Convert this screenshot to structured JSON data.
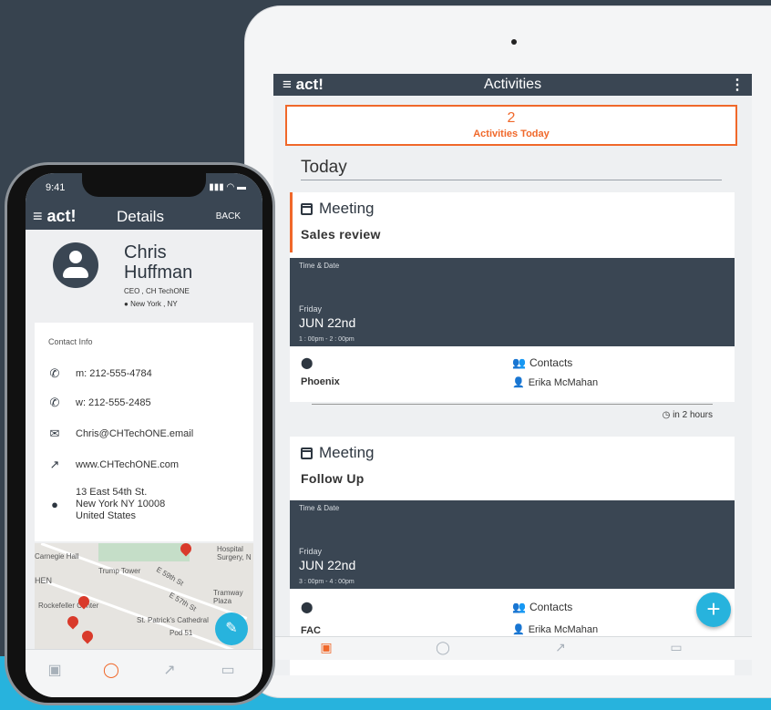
{
  "colors": {
    "accent": "#f0682a",
    "dark": "#3a4653",
    "fab": "#27b3dd"
  },
  "tablet": {
    "brand": "≡ act!",
    "title": "Activities",
    "summary": {
      "count": "2",
      "label": "Activities Today"
    },
    "section": "Today",
    "activities": [
      {
        "type": "Meeting",
        "name": "Sales review",
        "datetime_header": "Time & Date",
        "day": "Friday",
        "date": "JUN 22nd",
        "time": "1 : 00pm - 2 : 00pm",
        "location": "Phoenix",
        "contacts_header": "Contacts",
        "contact": "Erika McMahan",
        "due": "in 2 hours"
      },
      {
        "type": "Meeting",
        "name": "Follow Up",
        "datetime_header": "Time & Date",
        "day": "Friday",
        "date": "JUN 22nd",
        "time": "3 : 00pm - 4 : 00pm",
        "location": "FAC",
        "contacts_header": "Contacts",
        "contact": "Erika McMahan"
      }
    ],
    "nav": [
      "calendar-icon",
      "contact-icon",
      "chart-icon",
      "money-icon"
    ],
    "fab_label": "+"
  },
  "phone": {
    "status_time": "9:41",
    "brand": "≡ act!",
    "title": "Details",
    "back": "BACK",
    "first_name": "Chris",
    "last_name": "Huffman",
    "job": "CEO , CH TechONE",
    "location": "New York , NY",
    "contact_info_label": "Contact Info",
    "mobile": "m: 212-555-4784",
    "work": "w: 212-555-2485",
    "email": "Chris@CHTechONE.email",
    "website": "www.CHTechONE.com",
    "address_lines": [
      "13 East 54th St.",
      "New York NY 10008",
      "United States"
    ],
    "map_labels": [
      "Carnegie Hall",
      "Trump Tower",
      "HEN",
      "Rockefeller Center",
      "St. Patrick's Cathedral",
      "Pod 51",
      "Tramway Plaza",
      "Hospital Surgery, N",
      "E 57th St",
      "E 59th St"
    ]
  }
}
